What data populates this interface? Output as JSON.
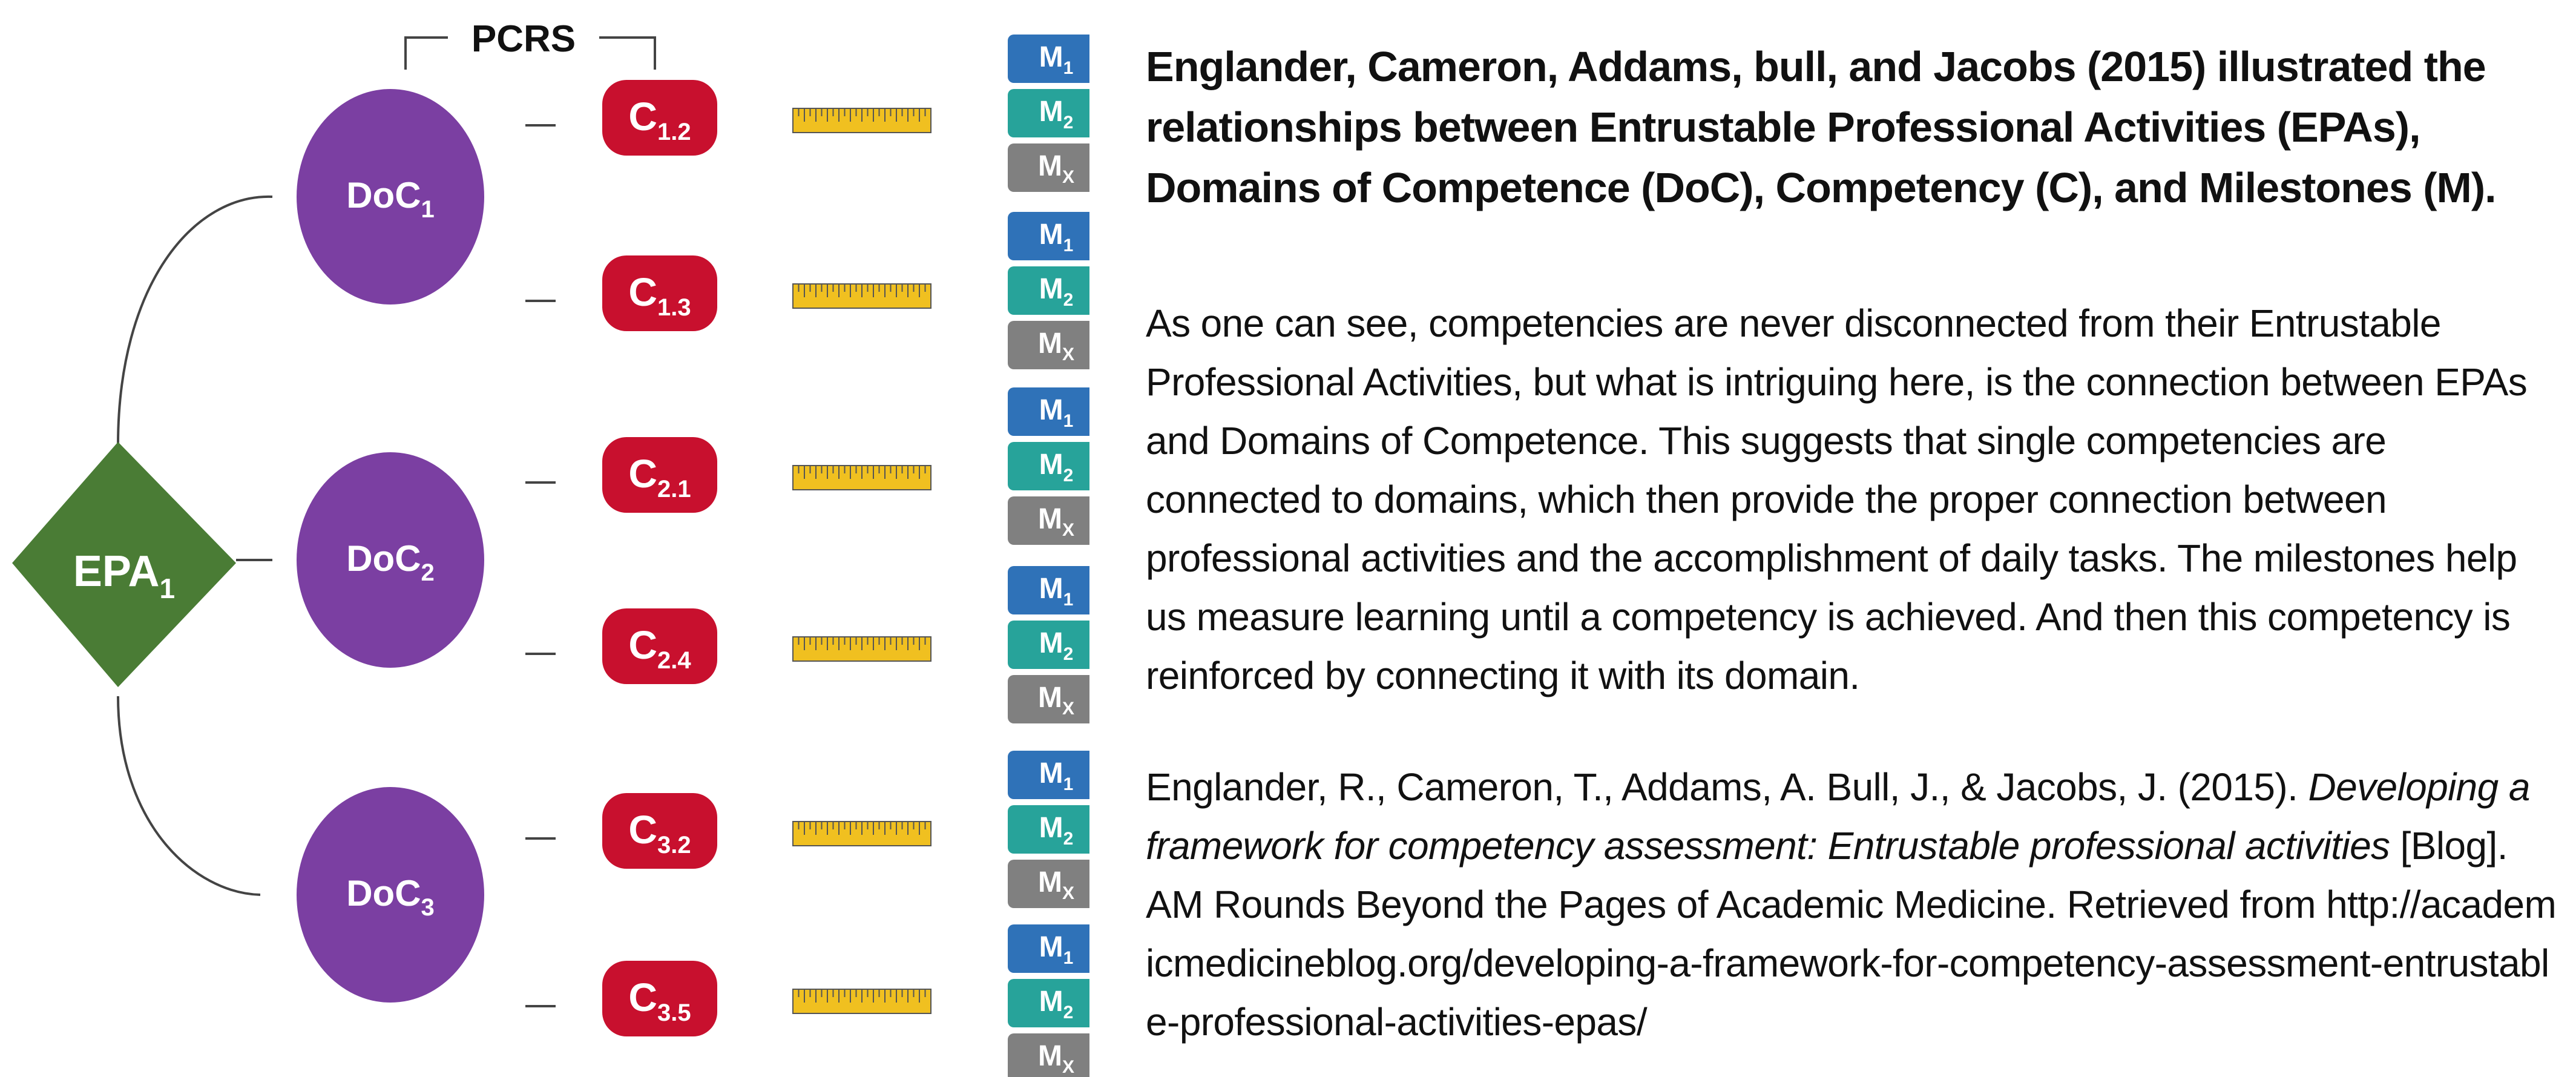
{
  "diagram": {
    "pcrs_label": "PCRS",
    "epa": {
      "base": "EPA",
      "sub": "1"
    },
    "domains": [
      {
        "base": "DoC",
        "sub": "1"
      },
      {
        "base": "DoC",
        "sub": "2"
      },
      {
        "base": "DoC",
        "sub": "3"
      }
    ],
    "competencies": [
      {
        "base": "C",
        "sub": "1.2"
      },
      {
        "base": "C",
        "sub": "1.3"
      },
      {
        "base": "C",
        "sub": "2.1"
      },
      {
        "base": "C",
        "sub": "2.4"
      },
      {
        "base": "C",
        "sub": "3.2"
      },
      {
        "base": "C",
        "sub": "3.5"
      }
    ],
    "milestones": [
      {
        "base": "M",
        "sub": "1"
      },
      {
        "base": "M",
        "sub": "2"
      },
      {
        "base": "M",
        "sub": "X"
      }
    ],
    "colors": {
      "epa": "#4a7c35",
      "domain": "#7b3fa2",
      "competency": "#c8102e",
      "ruler": "#f0c020",
      "m1": "#2f72b8",
      "m2": "#27a39a",
      "mx": "#808080",
      "line": "#444444"
    }
  },
  "text": {
    "headline": "Englander, Cameron, Addams, bull, and Jacobs (2015) illustrated the relationships between Entrustable Professional Activities (EPAs), Domains of Competence (DoC), Competency (C), and Milestones (M).",
    "paragraph": "As one can see, competencies are never disconnected from their Entrustable Professional Activities, but what is intriguing here, is the connection between EPAs and Domains of Competence. This suggests that single competencies are connected to domains, which then provide the proper connection between professional activities and the accomplishment of daily tasks. The milestones help us measure learning until a competency is achieved. And then this competency is reinforced by connecting it with its domain.",
    "citation_authors": "Englander, R., Cameron, T., Addams, A. Bull, J., & Jacobs, J. (2015). ",
    "citation_title": "Developing a framework for competency assessment: Entrustable professional activities",
    "citation_rest": " [Blog]. AM Rounds Beyond the Pages of Academic Medicine. Retrieved from ",
    "citation_url": "http://academicmedicineblog.org/developing-a-framework-for-competency-assessment-entrustable-professional-activities-epas/"
  }
}
